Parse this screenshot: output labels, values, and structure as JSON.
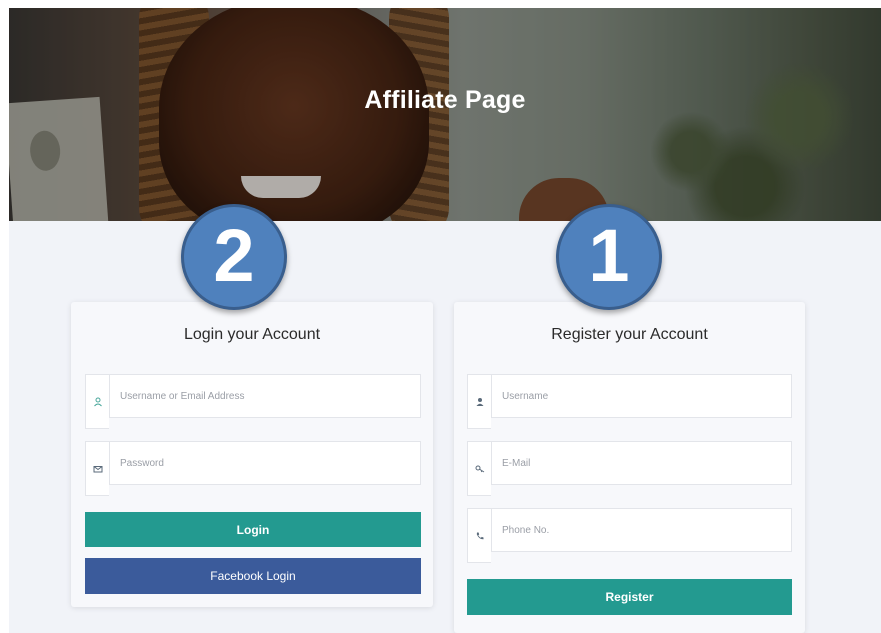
{
  "hero": {
    "title": "Affiliate Page"
  },
  "badges": {
    "login_step": "2",
    "register_step": "1"
  },
  "login": {
    "title": "Login your Account",
    "username_placeholder": "Username or Email Address",
    "password_placeholder": "Password",
    "login_button": "Login",
    "facebook_button": "Facebook Login"
  },
  "register": {
    "title": "Register your Account",
    "username_placeholder": "Username",
    "email_placeholder": "E-Mail",
    "phone_placeholder": "Phone No.",
    "register_button": "Register"
  },
  "icons": {
    "login_username": "user-icon",
    "login_password": "envelope-icon",
    "register_username": "user-icon",
    "register_email": "key-icon",
    "register_phone": "phone-icon"
  },
  "colors": {
    "primary_button": "#239a90",
    "facebook_button": "#3b5b9b",
    "badge": "#4f81bd",
    "page_background": "#f1f3f8"
  }
}
